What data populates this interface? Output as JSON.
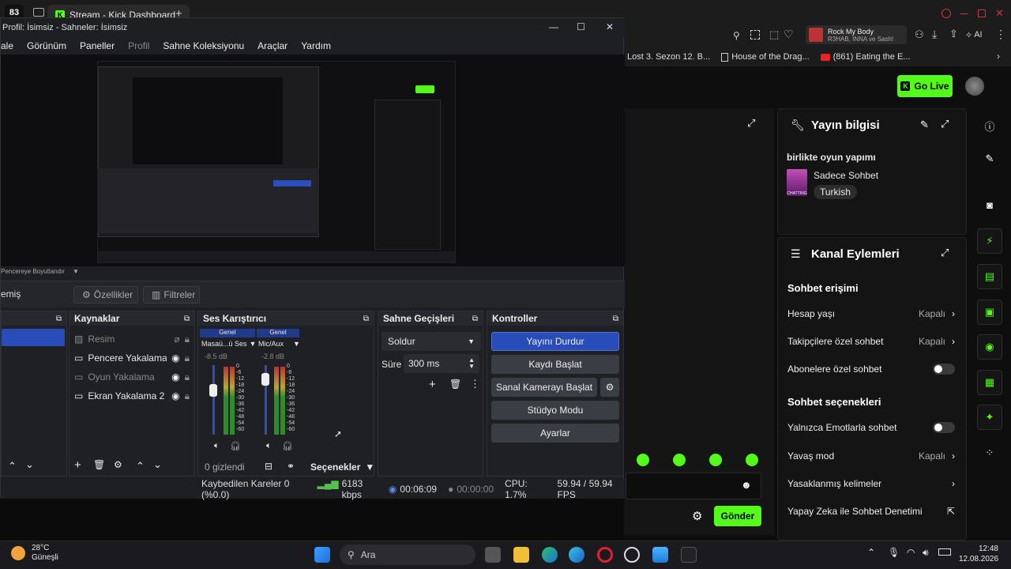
{
  "browser": {
    "tab_count": "83",
    "tab_title": "Stream - Kick Dashboard",
    "new_tab": "+",
    "bookmarks": [
      "Lost 3. Sezon 12. B...",
      "House of the Drag...",
      "(861) Eating the E..."
    ],
    "media_title": "Rock My Body",
    "media_artist": "R3HAB, INNA ve Sash!",
    "ai_label": "AI"
  },
  "kick": {
    "go_live": "Go Live",
    "stream_info": {
      "title": "Yayın bilgisi",
      "stream_title": "birlikte oyun yapımı",
      "category": "Sadece Sohbet",
      "language": "Turkish",
      "thumb_text": "CHATTING"
    },
    "channel_actions": {
      "title": "Kanal Eylemleri",
      "chat_access_heading": "Sohbet erişimi",
      "account_age_label": "Hesap yaşı",
      "account_age_value": "Kapalı",
      "followers_label": "Takipçilere özel sohbet",
      "followers_value": "Kapalı",
      "subs_label": "Abonelere özel sohbet",
      "chat_options_heading": "Sohbet seçenekleri",
      "emote_only_label": "Yalnızca Emotlarla sohbet",
      "slow_mode_label": "Yavaş mod",
      "slow_mode_value": "Kapalı",
      "banned_words_label": "Yasaklanmış kelimeler",
      "ai_moderation_label": "Yapay Zeka ile Sohbet Denetimi"
    },
    "send_button": "Gönder"
  },
  "obs": {
    "window_title": "Profil: İsimsiz - Sahneler: İsimsiz",
    "menu": [
      "ale",
      "Görünüm",
      "Paneller",
      "Profil",
      "Sahne Koleksiyonu",
      "Araçlar",
      "Yardım"
    ],
    "preview_tag": "Pencereye Boyutlandır",
    "no_source": "emiş",
    "properties_button": "Özellikler",
    "filters_button": "Filtreler",
    "sources": {
      "title": "Kaynaklar",
      "items": [
        "Resim",
        "Pencere Yakalama",
        "Oyun Yakalama",
        "Ekran Yakalama 2"
      ]
    },
    "mixer": {
      "title": "Ses Karıştırıcı",
      "channels": [
        {
          "group": "Genel",
          "name": "Masaü...ü Ses",
          "db": "-8.5 dB"
        },
        {
          "group": "Genel",
          "name": "Mic/Aux",
          "db": "-2.8 dB"
        }
      ],
      "scale": [
        "0",
        "-6",
        "-12",
        "-18",
        "-24",
        "-30",
        "-36",
        "-42",
        "-48",
        "-54",
        "-60"
      ],
      "hidden_count": "0 gizlendi",
      "options": "Seçenekler"
    },
    "transitions": {
      "title": "Sahne Geçişleri",
      "selected": "Soldur",
      "duration_label": "Süre",
      "duration_value": "300 ms"
    },
    "controls": {
      "title": "Kontroller",
      "stop_stream": "Yayını Durdur",
      "start_recording": "Kaydı Başlat",
      "virtual_cam": "Sanal Kamerayı Başlat",
      "studio_mode": "Stüdyo Modu",
      "settings": "Ayarlar"
    },
    "status": {
      "dropped_frames": "Kaybedilen Kareler 0 (%0.0)",
      "bitrate": "6183 kbps",
      "stream_time": "00:06:09",
      "rec_time": "00:00:00",
      "cpu": "CPU: 1.7%",
      "fps": "59.94 / 59.94 FPS"
    }
  },
  "taskbar": {
    "temperature": "28°C",
    "weather": "Güneşli",
    "search_placeholder": "Ara",
    "time": "12:48",
    "date": "12.08.2026"
  },
  "colors": {
    "kick_green": "#53fc18",
    "obs_blue": "#284cb8"
  }
}
